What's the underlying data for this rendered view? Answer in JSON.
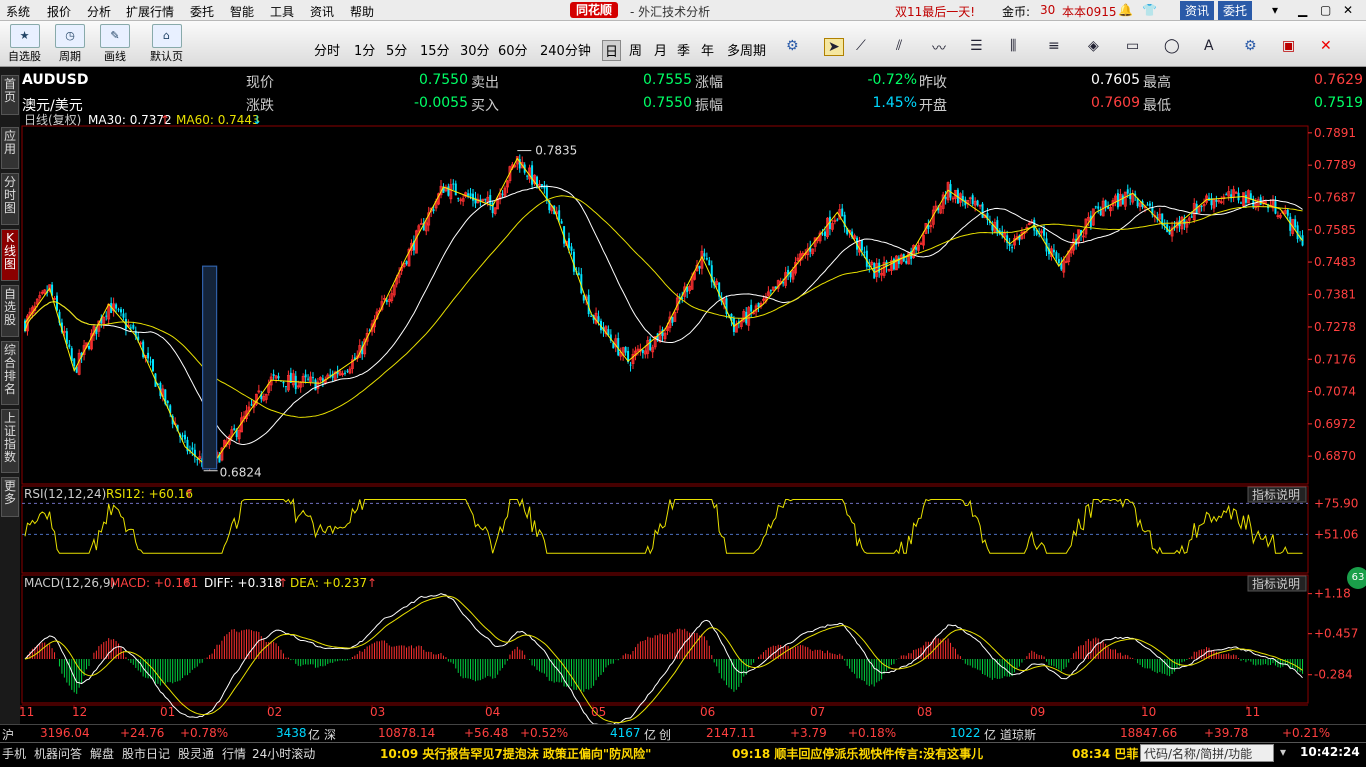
{
  "menu": [
    "系统",
    "报价",
    "分析",
    "扩展行情",
    "委托",
    "智能",
    "工具",
    "资讯",
    "帮助"
  ],
  "app": {
    "logo": "同花顺",
    "title": "- 外汇技术分析",
    "promo": "双11最后一天!",
    "gold_label": "金币:",
    "gold_value": "30",
    "version": "本本0915",
    "btn_news": "资讯",
    "btn_trade": "委托"
  },
  "toolbar": {
    "buttons": [
      "自选股",
      "周期",
      "画线",
      "默认页"
    ],
    "periods": [
      "分时",
      "1分",
      "5分",
      "15分",
      "30分",
      "60分",
      "240分钟",
      "日",
      "周",
      "月",
      "季",
      "年",
      "多周期"
    ],
    "selected": "日"
  },
  "leftnav": [
    "首页",
    "应用",
    "分时图",
    "K线图",
    "自选股",
    "综合排名",
    "上证指数",
    "更多"
  ],
  "quote": {
    "symbol": "AUDUSD",
    "name": "澳元/美元",
    "row1": [
      [
        "现价",
        "0.7550"
      ],
      [
        "卖出",
        "0.7555"
      ],
      [
        "涨幅",
        "-0.72%"
      ],
      [
        "昨收",
        "0.7605"
      ],
      [
        "最高",
        "0.7629"
      ]
    ],
    "row2": [
      [
        "涨跌",
        "-0.0055"
      ],
      [
        "买入",
        "0.7550"
      ],
      [
        "振幅",
        "1.45%"
      ],
      [
        "开盘",
        "0.7609"
      ],
      [
        "最低",
        "0.7519"
      ]
    ]
  },
  "colors": {
    "up": "#ff3030",
    "down": "#00e5ff",
    "ma30": "#ffffff",
    "ma60": "#e8e000",
    "rsi": "#e8e000",
    "diff": "#ffffff",
    "dea": "#e8e000",
    "label_green": "#00ff66",
    "label_red": "#ff4040",
    "label_cyan": "#00d8ff",
    "grid": "#7a0000"
  },
  "chart_data": [
    {
      "type": "candlestick",
      "title": "日线(复权)",
      "legend": [
        {
          "name": "MA30",
          "value": "0.7372"
        },
        {
          "name": "MA60",
          "value": "0.7443"
        }
      ],
      "ylim": [
        0.682,
        0.79
      ],
      "y_ticks": [
        "0.7891",
        "0.7789",
        "0.7687",
        "0.7585",
        "0.7483",
        "0.7381",
        "0.7278",
        "0.7176",
        "0.7074",
        "0.6972",
        "0.6870"
      ],
      "annotations": [
        {
          "text": "0.7835",
          "x": "05",
          "y": 0.7835
        },
        {
          "text": "0.6824",
          "x": "01",
          "y": 0.6824
        }
      ],
      "x_ticks": [
        "11",
        "12",
        "01",
        "02",
        "03",
        "04",
        "05",
        "06",
        "07",
        "08",
        "09",
        "10",
        "11"
      ],
      "anchors": [
        [
          0,
          0.729
        ],
        [
          10,
          0.74
        ],
        [
          20,
          0.714
        ],
        [
          34,
          0.735
        ],
        [
          45,
          0.725
        ],
        [
          65,
          0.69
        ],
        [
          75,
          0.683
        ],
        [
          100,
          0.711
        ],
        [
          120,
          0.71
        ],
        [
          135,
          0.718
        ],
        [
          155,
          0.75
        ],
        [
          170,
          0.772
        ],
        [
          190,
          0.766
        ],
        [
          200,
          0.781
        ],
        [
          215,
          0.765
        ],
        [
          230,
          0.732
        ],
        [
          245,
          0.717
        ],
        [
          260,
          0.727
        ],
        [
          275,
          0.75
        ],
        [
          288,
          0.728
        ],
        [
          300,
          0.735
        ],
        [
          315,
          0.749
        ],
        [
          330,
          0.764
        ],
        [
          345,
          0.745
        ],
        [
          360,
          0.751
        ],
        [
          375,
          0.771
        ],
        [
          390,
          0.763
        ],
        [
          400,
          0.754
        ],
        [
          410,
          0.76
        ],
        [
          420,
          0.747
        ],
        [
          435,
          0.764
        ],
        [
          450,
          0.77
        ],
        [
          465,
          0.758
        ],
        [
          480,
          0.768
        ],
        [
          495,
          0.769
        ],
        [
          510,
          0.765
        ],
        [
          519,
          0.755
        ]
      ]
    },
    {
      "type": "line",
      "title": "RSI(12,12,24)",
      "legend": [
        {
          "name": "RSI12",
          "value": "+60.16"
        }
      ],
      "y_ticks": [
        "+75.90",
        "+51.06"
      ],
      "button": "指标说明"
    },
    {
      "type": "bar+line",
      "title": "MACD(12,26,9)",
      "legend": [
        {
          "name": "MACD",
          "value": "+0.161"
        },
        {
          "name": "DIFF",
          "value": "+0.318"
        },
        {
          "name": "DEA",
          "value": "+0.237"
        }
      ],
      "y_ticks": [
        "+1.18",
        "+0.457",
        "-0.284"
      ],
      "button": "指标说明"
    }
  ],
  "status": {
    "sh": "沪",
    "sh_val": "3196.04",
    "sh_chg": "+24.76",
    "sh_pct": "+0.78%",
    "sh_amt": "3438",
    "unit": "亿",
    "sz": "深",
    "sz_val": "10878.14",
    "sz_chg": "+56.48",
    "sz_pct": "+0.52%",
    "sz_amt": "4167",
    "cy": "创",
    "cy_val": "2147.11",
    "cy_chg": "+3.79",
    "cy_pct": "+0.18%",
    "cy_amt": "1022",
    "dj": "道琼斯",
    "dj_val": "18847.66",
    "dj_chg": "+39.78",
    "dj_pct": "+0.21%"
  },
  "bottom": {
    "tabs": [
      "手机",
      "机器问答",
      "解盘",
      "股市日记",
      "股灵通",
      "行情",
      "24小时滚动"
    ],
    "news1": "10:09 央行报告罕见7提泡沫 政策正偏向\"防风险\"",
    "news2": "09:18 顺丰回应停派乐视快件传言:没有这事儿",
    "news3": "08:34 巴菲",
    "search": "代码/名称/简拼/功能",
    "time": "10:42:24",
    "badge": "63"
  }
}
